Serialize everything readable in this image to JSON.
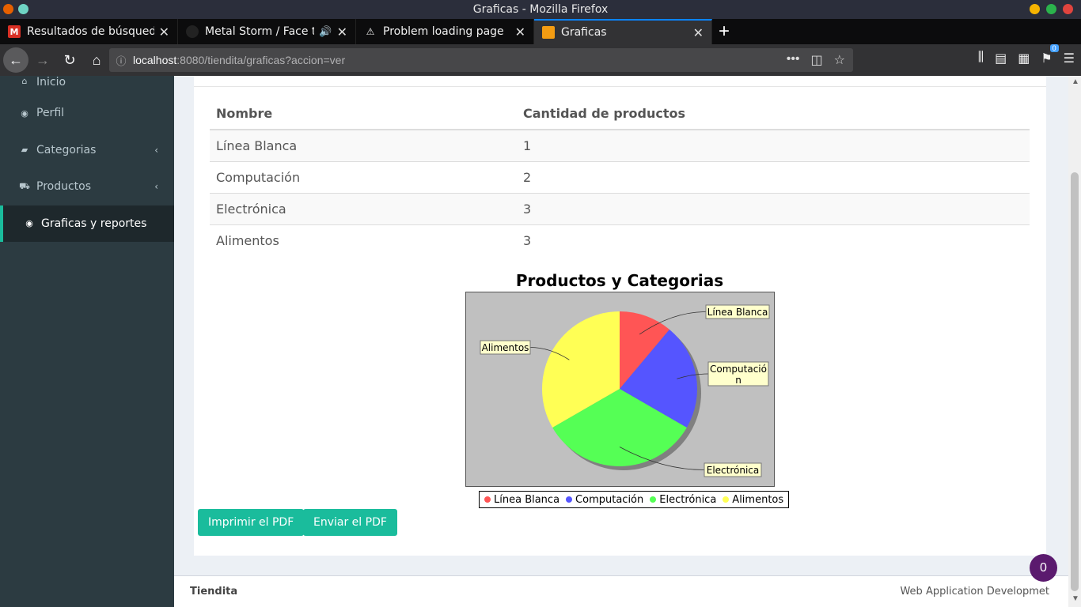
{
  "window": {
    "title": "Graficas - Mozilla Firefox"
  },
  "tabs": [
    {
      "label": "Resultados de búsqueda - ",
      "icon": "gmail-icon",
      "active": false
    },
    {
      "label": "Metal Storm / Face the S",
      "icon": "metal-storm-icon",
      "active": false,
      "audio": true
    },
    {
      "label": "Problem loading page",
      "icon": "warning-icon",
      "active": false
    },
    {
      "label": "Graficas",
      "icon": "site-favicon",
      "active": true
    }
  ],
  "navbar": {
    "url_host": "localhost",
    "url_path": ":8080/tiendita/graficas?accion=ver",
    "library_badge": "0"
  },
  "sidebar": {
    "items": [
      {
        "label": "Inicio",
        "icon": "home-icon",
        "chevron": false,
        "active": false
      },
      {
        "label": "Perfil",
        "icon": "user-circle-icon",
        "chevron": false,
        "active": false
      },
      {
        "label": "Categorias",
        "icon": "book-icon",
        "chevron": true,
        "active": false
      },
      {
        "label": "Productos",
        "icon": "cart-icon",
        "chevron": true,
        "active": false
      },
      {
        "label": "Graficas y reportes",
        "icon": "user-circle-icon",
        "chevron": false,
        "active": true
      }
    ]
  },
  "table": {
    "headers": [
      "Nombre",
      "Cantidad de productos"
    ],
    "rows": [
      [
        "Línea Blanca",
        "1"
      ],
      [
        "Computación",
        "2"
      ],
      [
        "Electrónica",
        "3"
      ],
      [
        "Alimentos",
        "3"
      ]
    ]
  },
  "chart_data": {
    "type": "pie",
    "title": "Productos y Categorias",
    "categories": [
      "Línea Blanca",
      "Computación",
      "Electrónica",
      "Alimentos"
    ],
    "values": [
      1,
      2,
      3,
      3
    ],
    "colors": [
      "#ff5555",
      "#5555ff",
      "#55ff55",
      "#ffff55"
    ],
    "label_lines": [
      "Línea Blanca",
      "Computació\nn",
      "Electrónica",
      "Alimentos"
    ],
    "legend": "bottom",
    "background": "#c0c0c0"
  },
  "buttons": {
    "print": "Imprimir el PDF",
    "send": "Enviar el PDF"
  },
  "footer": {
    "left": "Tiendita",
    "right": "Web Application Developmet"
  },
  "float_badge": "0"
}
